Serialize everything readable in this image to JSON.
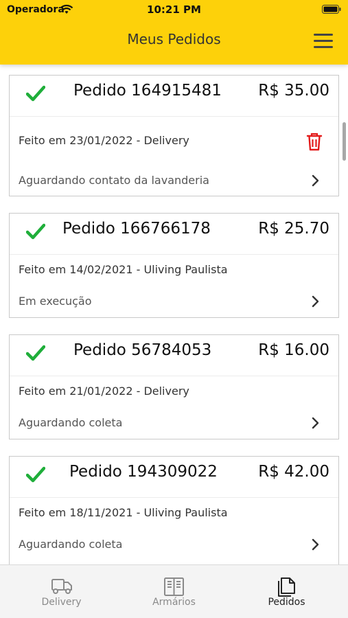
{
  "status_bar": {
    "carrier": "Operadora",
    "time": "10:21 PM"
  },
  "header": {
    "title": "Meus Pedidos"
  },
  "orders": [
    {
      "number": "Pedido 164915481",
      "price": "R$ 35.00",
      "made": "Feito em 23/01/2022 - Delivery",
      "status": "Aguardando contato da lavanderia",
      "deletable": true
    },
    {
      "number": "Pedido 166766178",
      "price": "R$ 25.70",
      "made": "Feito em 14/02/2021 - Uliving Paulista",
      "status": "Em execução",
      "deletable": false
    },
    {
      "number": "Pedido 56784053",
      "price": "R$ 16.00",
      "made": "Feito em 21/01/2022 - Delivery",
      "status": "Aguardando coleta",
      "deletable": false
    },
    {
      "number": "Pedido 194309022",
      "price": "R$ 42.00",
      "made": "Feito em 18/11/2021 - Uliving Paulista",
      "status": "Aguardando coleta",
      "deletable": false
    }
  ],
  "tabs": [
    {
      "label": "Delivery",
      "icon": "truck-icon",
      "active": false
    },
    {
      "label": "Armários",
      "icon": "lockers-icon",
      "active": false
    },
    {
      "label": "Pedidos",
      "icon": "documents-icon",
      "active": true
    }
  ],
  "colors": {
    "header_bg": "#fdd10a",
    "check": "#1fae3a",
    "delete": "#e31b1b"
  }
}
